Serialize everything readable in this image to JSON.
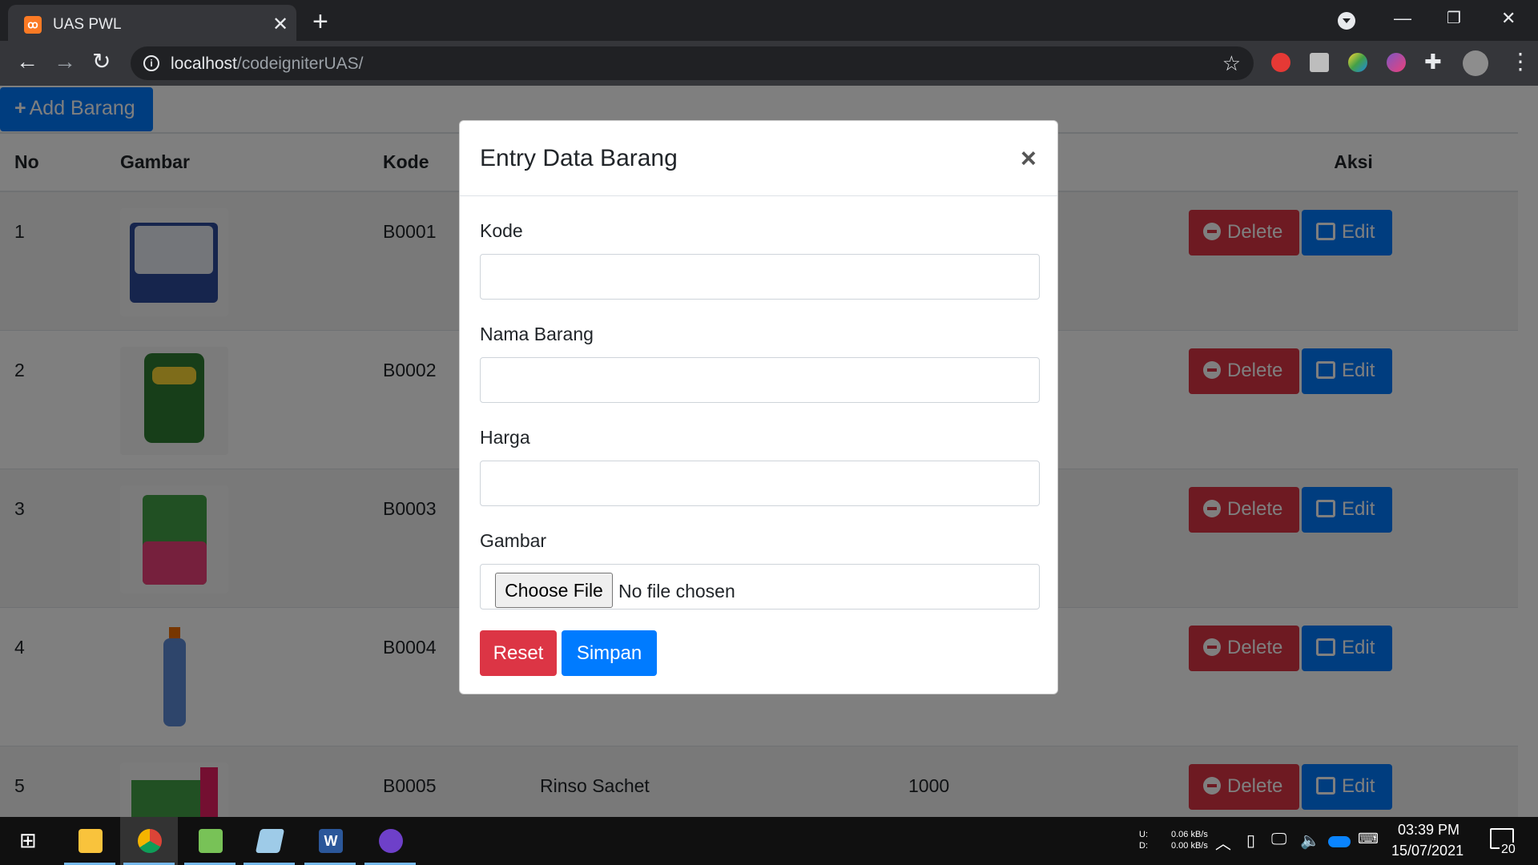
{
  "browser": {
    "tab_title": "UAS PWL",
    "tab_icon": "xampp-icon",
    "url_host": "localhost",
    "url_path": "/codeigniterUAS/"
  },
  "page": {
    "add_button_label": "Add Barang",
    "table": {
      "headers": {
        "no": "No",
        "gambar": "Gambar",
        "kode": "Kode",
        "aksi": "Aksi"
      },
      "rows": [
        {
          "no": "1",
          "kode": "B0001",
          "nama": "",
          "harga": ""
        },
        {
          "no": "2",
          "kode": "B0002",
          "nama": "",
          "harga": ""
        },
        {
          "no": "3",
          "kode": "B0003",
          "nama": "",
          "harga": ""
        },
        {
          "no": "4",
          "kode": "B0004",
          "nama": "",
          "harga": ""
        },
        {
          "no": "5",
          "kode": "B0005",
          "nama": "Rinso Sachet",
          "harga": "1000"
        }
      ],
      "delete_label": "Delete",
      "edit_label": "Edit"
    }
  },
  "modal": {
    "title": "Entry Data Barang",
    "close": "×",
    "fields": {
      "kode_label": "Kode",
      "kode_value": "",
      "nama_label": "Nama Barang",
      "nama_value": "",
      "harga_label": "Harga",
      "harga_value": "",
      "gambar_label": "Gambar",
      "choose_file": "Choose File",
      "no_file": "No file chosen"
    },
    "reset_label": "Reset",
    "simpan_label": "Simpan"
  },
  "taskbar": {
    "net_up": "0.06 kB/s",
    "net_down": "0.00 kB/s",
    "net_u_label": "U:",
    "net_d_label": "D:",
    "time": "03:39 PM",
    "date": "15/07/2021",
    "notification_count": "20"
  },
  "colors": {
    "primary": "#007bff",
    "danger": "#dc3545",
    "chrome_dark": "#202124"
  }
}
